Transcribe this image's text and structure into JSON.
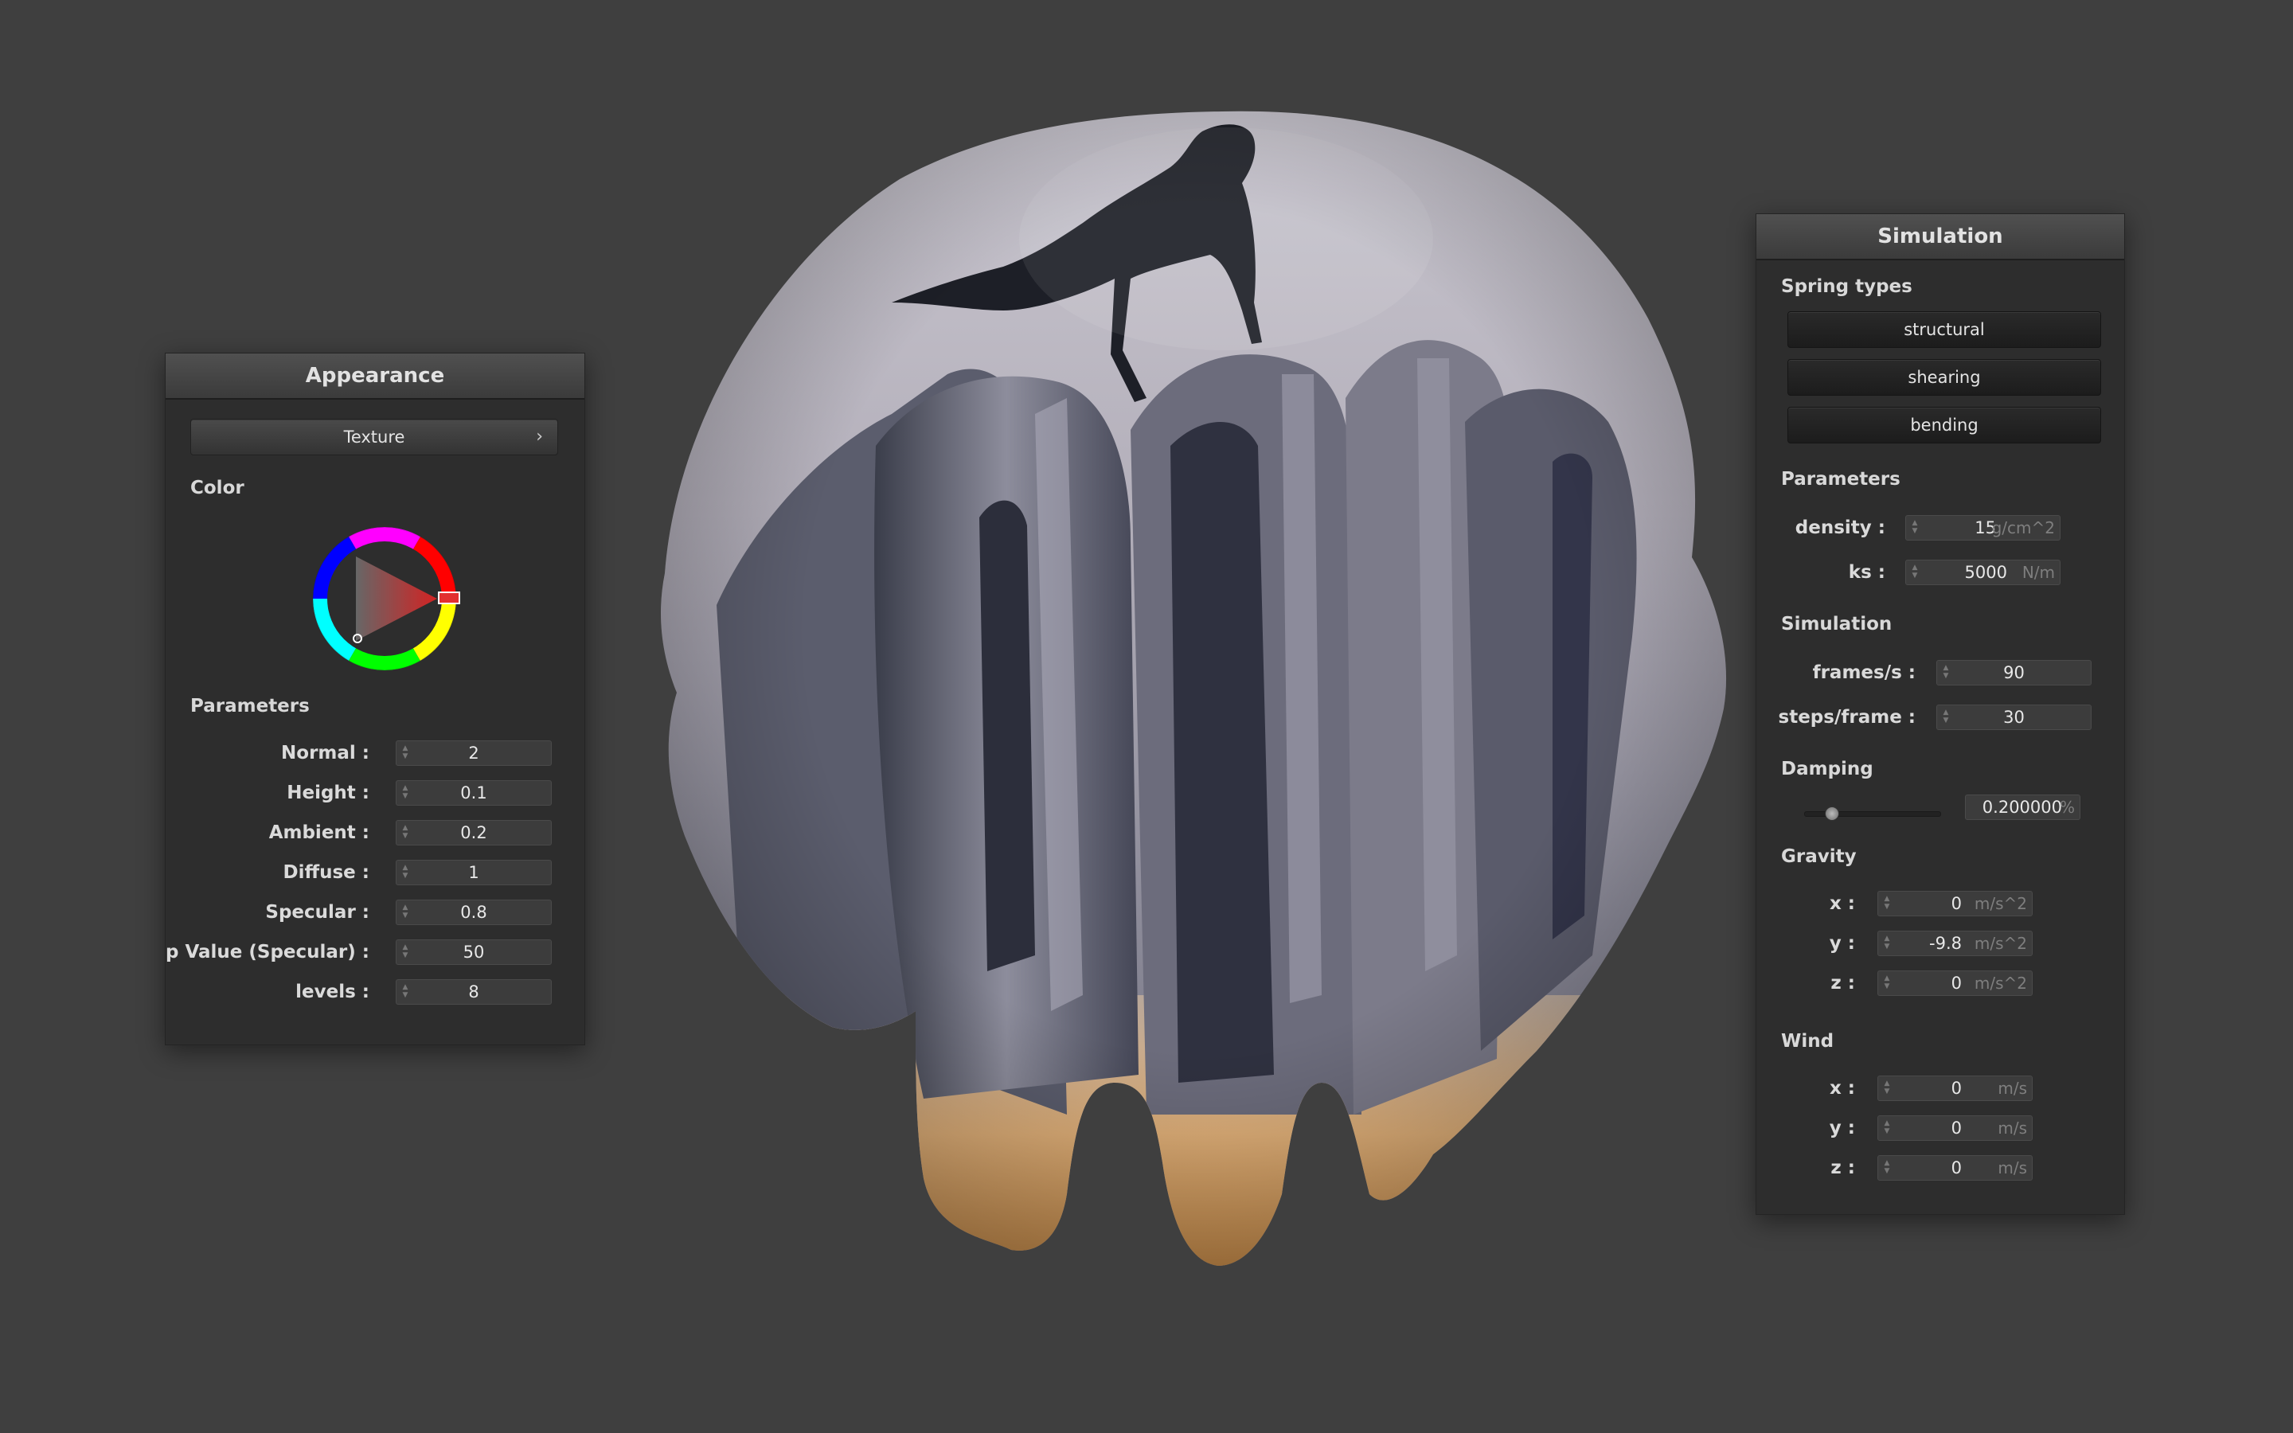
{
  "appearance": {
    "title": "Appearance",
    "texture_button": "Texture",
    "color_label": "Color",
    "color_value": "#d01010",
    "parameters_label": "Parameters",
    "params": [
      {
        "label": "Normal :",
        "value": "2"
      },
      {
        "label": "Height :",
        "value": "0.1"
      },
      {
        "label": "Ambient :",
        "value": "0.2"
      },
      {
        "label": "Diffuse :",
        "value": "1"
      },
      {
        "label": "Specular :",
        "value": "0.8"
      },
      {
        "label": "p Value (Specular) :",
        "value": "50"
      },
      {
        "label": "levels :",
        "value": "8"
      }
    ]
  },
  "simulation": {
    "title": "Simulation",
    "spring_types_label": "Spring types",
    "spring_buttons": [
      "structural",
      "shearing",
      "bending"
    ],
    "parameters_label": "Parameters",
    "density": {
      "label": "density :",
      "value": "15",
      "unit": "g/cm^2"
    },
    "ks": {
      "label": "ks :",
      "value": "5000",
      "unit": "N/m"
    },
    "simulation_label": "Simulation",
    "frames": {
      "label": "frames/s :",
      "value": "90"
    },
    "steps": {
      "label": "steps/frame :",
      "value": "30"
    },
    "damping_label": "Damping",
    "damping": {
      "value": "0.200000",
      "unit": "%",
      "slider_fraction": 0.2
    },
    "gravity_label": "Gravity",
    "gravity": [
      {
        "label": "x :",
        "value": "0",
        "unit": "m/s^2"
      },
      {
        "label": "y :",
        "value": "-9.8",
        "unit": "m/s^2"
      },
      {
        "label": "z :",
        "value": "0",
        "unit": "m/s^2"
      }
    ],
    "wind_label": "Wind",
    "wind": [
      {
        "label": "x :",
        "value": "0",
        "unit": "m/s"
      },
      {
        "label": "y :",
        "value": "0",
        "unit": "m/s"
      },
      {
        "label": "z :",
        "value": "0",
        "unit": "m/s"
      }
    ]
  }
}
